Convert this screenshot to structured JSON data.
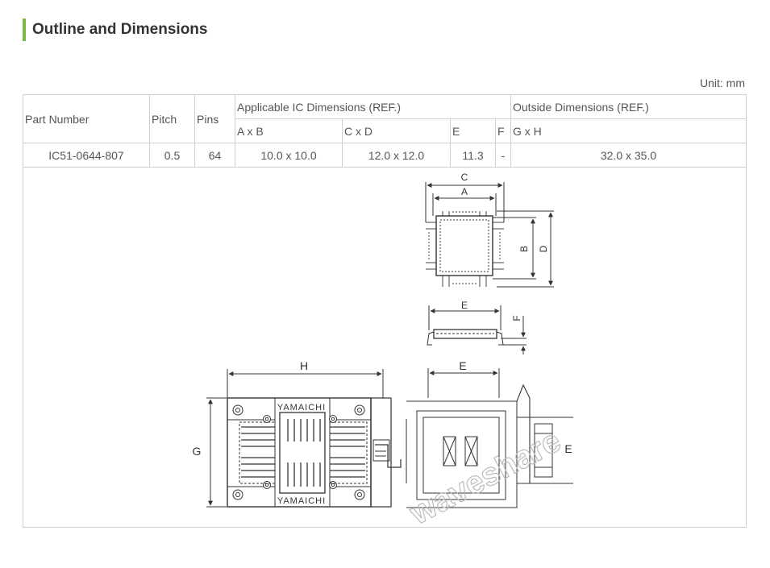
{
  "page_title": "Outline and Dimensions",
  "unit_label": "Unit: mm",
  "table": {
    "headers": {
      "part_number": "Part Number",
      "pitch": "Pitch",
      "pins": "Pins",
      "applicable": "Applicable IC Dimensions (REF.)",
      "outside": "Outside Dimensions (REF.)",
      "axb": "A x B",
      "cxd": "C x D",
      "e": "E",
      "f": "F",
      "gxh": "G x H"
    },
    "row": {
      "part_number": "IC51-0644-807",
      "pitch": "0.5",
      "pins": "64",
      "axb": "10.0 x 10.0",
      "cxd": "12.0 x 12.0",
      "e": "11.3",
      "f": "-",
      "gxh": "32.0 x 35.0"
    }
  },
  "drawing": {
    "labels": {
      "c": "C",
      "a": "A",
      "b": "B",
      "d": "D",
      "e_side": "E",
      "f": "F",
      "h": "H",
      "g": "G",
      "e_socket_top": "E",
      "e_socket_right": "E"
    },
    "brand_top": "YAMAICHI",
    "brand_bottom": "YAMAICHI",
    "watermark": "waveshare"
  },
  "colors": {
    "accent": "#7ab648",
    "border": "#cfcfcf",
    "line": "#333333"
  }
}
